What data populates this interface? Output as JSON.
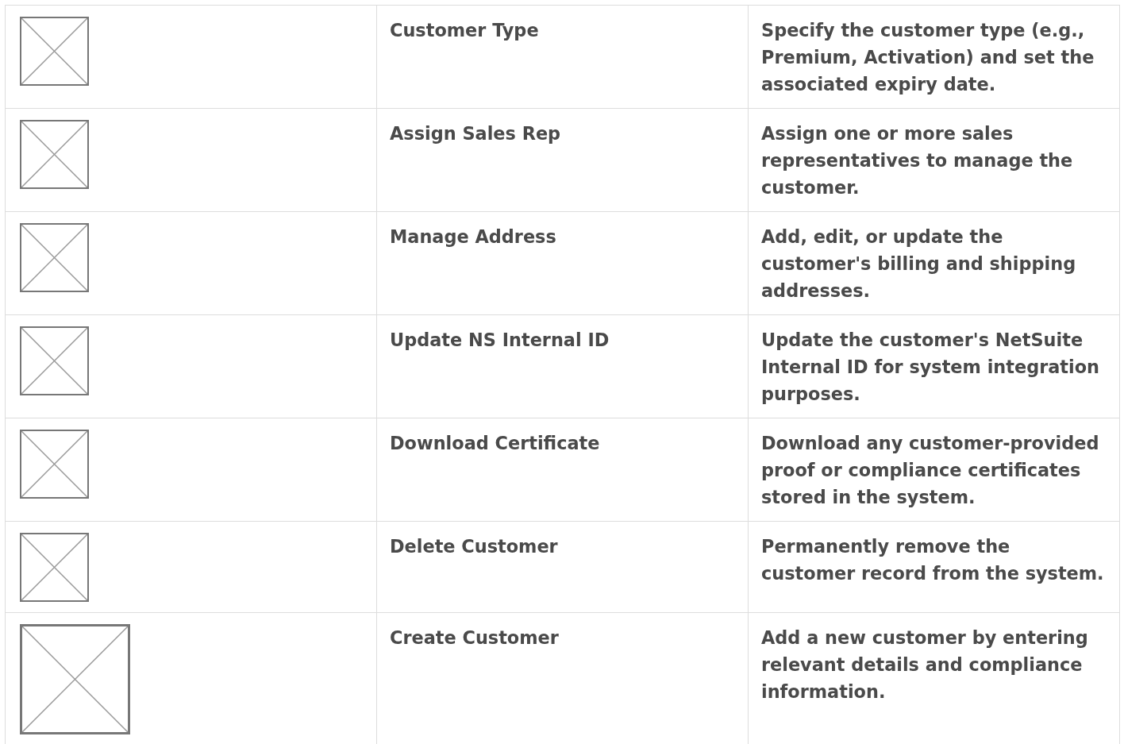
{
  "table": {
    "rows": [
      {
        "kind": "small",
        "action": "Customer Type",
        "description": "Specify the customer type (e.g., Premium, Activation) and set the associated expiry date."
      },
      {
        "kind": "small",
        "action": "Assign Sales Rep",
        "description": "Assign one or more sales representatives to manage the customer."
      },
      {
        "kind": "small",
        "action": "Manage Address",
        "description": "Add, edit, or update the customer's billing and shipping addresses."
      },
      {
        "kind": "small",
        "action": "Update NS Internal ID",
        "description": "Update the customer's NetSuite Internal ID for system integration purposes."
      },
      {
        "kind": "small",
        "action": "Download Certificate",
        "description": "Download any customer-provided proof or compliance certificates stored in the system."
      },
      {
        "kind": "small",
        "action": "Delete Customer",
        "description": "Permanently remove the customer record from the system."
      },
      {
        "kind": "large",
        "action": "Create Customer",
        "description": "Add a new customer by entering relevant details and compliance information."
      }
    ]
  }
}
